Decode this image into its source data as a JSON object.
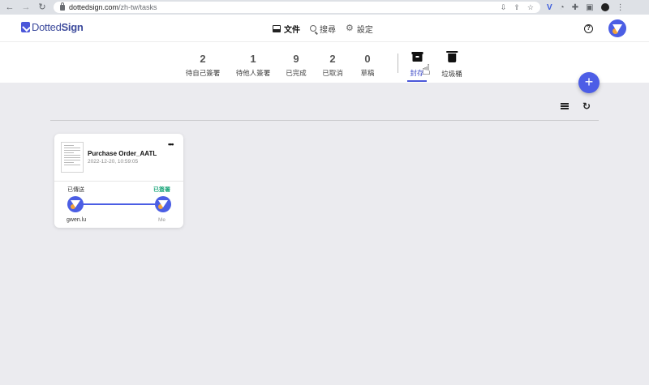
{
  "browser": {
    "url_host": "dottedsign.com",
    "url_path": "/zh-tw/tasks",
    "back_icon": "arrow-left-icon",
    "forward_icon": "arrow-right-icon",
    "reload_icon": "reload-icon"
  },
  "app": {
    "logo_bold": "Dotted",
    "logo_rest": "Sign",
    "nav": [
      {
        "label": "文件",
        "icon": "document-icon",
        "active": true
      },
      {
        "label": "搜尋",
        "icon": "search-icon",
        "active": false
      },
      {
        "label": "設定",
        "icon": "gear-icon",
        "active": false
      }
    ],
    "help_label": "?"
  },
  "stats": [
    {
      "count": "2",
      "label": "待自己簽署"
    },
    {
      "count": "1",
      "label": "待他人簽署"
    },
    {
      "count": "9",
      "label": "已完成"
    },
    {
      "count": "2",
      "label": "已取消"
    },
    {
      "count": "0",
      "label": "草稿"
    }
  ],
  "folders": [
    {
      "label": "封存",
      "icon": "archive-icon",
      "active": true
    },
    {
      "label": "垃圾桶",
      "icon": "trash-icon",
      "active": false
    }
  ],
  "fab_label": "+",
  "toolbar": {
    "list_icon": "list-view-icon",
    "refresh_icon": "refresh-icon"
  },
  "card": {
    "title": "Purchase Order_AATL",
    "date": "2022-12-20, 10:59:05",
    "more_label": "•••",
    "status_sent": "已傳送",
    "status_signed": "已簽署",
    "sender": "gwen.lu",
    "receiver": "Me"
  }
}
